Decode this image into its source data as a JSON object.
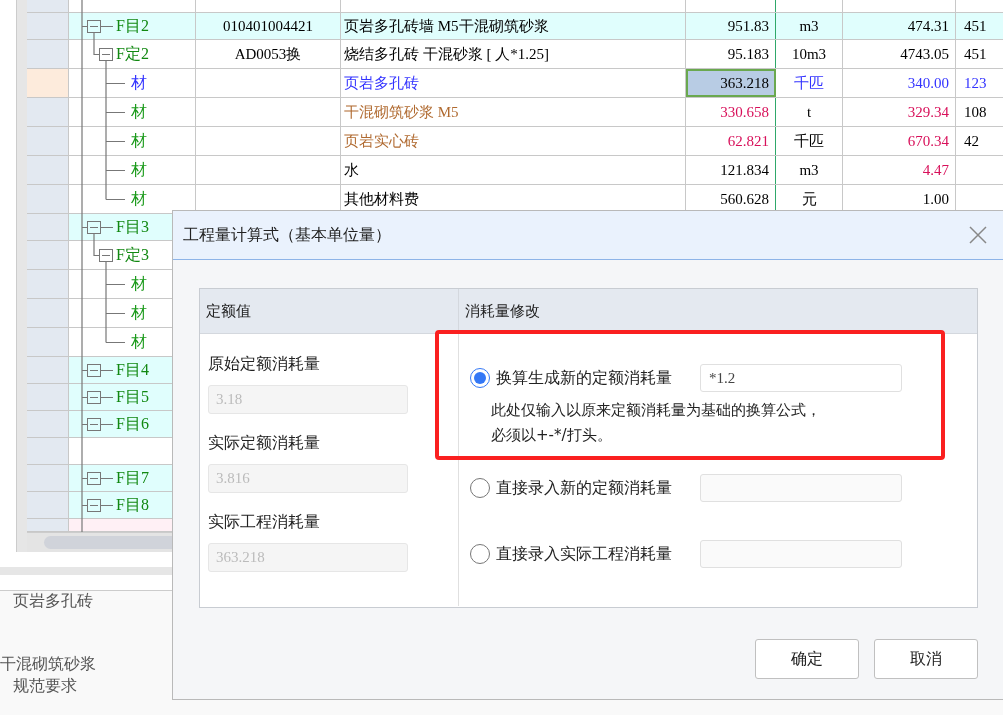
{
  "grid": {
    "rows": [
      {
        "kind": "material",
        "selected": false
      },
      {
        "kind": "item",
        "label": "F目2",
        "selected": false,
        "color": "#118811",
        "cells": {
          "code": {
            "text": "010401004421",
            "color": "#000000"
          },
          "name": {
            "text": "页岩多孔砖墙 M5干混砌筑砂浆",
            "color": "#000000"
          },
          "qty": {
            "text": "951.83",
            "color": "#000000"
          },
          "unit": {
            "text": "m3",
            "color": "#000000"
          },
          "price": {
            "text": "474.31",
            "color": "#000000"
          },
          "col_7": {
            "text": "451",
            "color": "#000000"
          }
        }
      },
      {
        "kind": "quota",
        "label": "F定2",
        "selected": false,
        "color": "#118811",
        "cells": {
          "code": {
            "text": "AD0053换",
            "color": "#000000"
          },
          "name": {
            "text": "烧结多孔砖 干混砂浆 [ 人*1.25]",
            "color": "#000000"
          },
          "qty": {
            "text": "95.183",
            "color": "#000000"
          },
          "unit": {
            "text": "10m3",
            "color": "#000000"
          },
          "price": {
            "text": "4743.05",
            "color": "#000000"
          },
          "col_7": {
            "text": "451",
            "color": "#000000"
          }
        }
      },
      {
        "kind": "material",
        "label": "材",
        "selected": true,
        "color": "#3333ff",
        "cells": {
          "name": {
            "text": "页岩多孔砖",
            "color": "#3333ff"
          },
          "qty": {
            "text": "363.218",
            "color": "#000000"
          },
          "unit": {
            "text": "千匹",
            "color": "#3333ff"
          },
          "price": {
            "text": "340.00",
            "color": "#3333ff"
          },
          "col_7": {
            "text": "123",
            "color": "#3333ff"
          }
        }
      },
      {
        "kind": "material",
        "label": "材",
        "selected": false,
        "color": "#1a9a1a",
        "cells": {
          "name": {
            "text": "干混砌筑砂浆 M5",
            "color": "#b06a30"
          },
          "qty": {
            "text": "330.658",
            "color": "#d8105a"
          },
          "unit": {
            "text": "t"
          },
          "price": {
            "text": "329.34",
            "color": "#d8105a"
          },
          "col_7": {
            "text": "108",
            "color": "#000000"
          }
        }
      },
      {
        "kind": "material",
        "label": "材",
        "selected": false,
        "color": "#1a9a1a",
        "cells": {
          "name": {
            "text": "页岩实心砖",
            "color": "#b06a30"
          },
          "qty": {
            "text": "62.821",
            "color": "#d8105a"
          },
          "unit": {
            "text": "千匹",
            "color": "#000000"
          },
          "price": {
            "text": "670.34",
            "color": "#d8105a"
          },
          "col_7": {
            "text": "42",
            "color": "#000000"
          }
        }
      },
      {
        "kind": "material",
        "label": "材",
        "selected": false,
        "color": "#1a9a1a",
        "cells": {
          "name": {
            "text": "水",
            "color": "#000000"
          },
          "qty": {
            "text": "121.834",
            "color": "#000000"
          },
          "unit": {
            "text": "m3",
            "color": "#000000"
          },
          "price": {
            "text": "4.47",
            "color": "#d8105a"
          }
        }
      },
      {
        "kind": "material",
        "label": "材",
        "selected": false,
        "color": "#1a9a1a",
        "cells": {
          "name": {
            "text": "其他材料费",
            "color": "#000000"
          },
          "qty": {
            "text": "560.628",
            "color": "#000000"
          },
          "unit": {
            "text": "元"
          },
          "price": {
            "text": "1.00",
            "color": "#000000"
          }
        }
      },
      {
        "kind": "item",
        "label": "F目3",
        "selected": false,
        "color": "#118811"
      },
      {
        "kind": "quota",
        "label": "F定3",
        "selected": false,
        "color": "#118811"
      },
      {
        "kind": "material",
        "label": "材",
        "selected": false,
        "color": "#1a9a1a"
      },
      {
        "kind": "material",
        "label": "材",
        "selected": false,
        "color": "#1a9a1a"
      },
      {
        "kind": "material",
        "label": "材",
        "selected": false,
        "color": "#1a9a1a"
      },
      {
        "kind": "item",
        "label": "F目4",
        "selected": false,
        "color": "#118811"
      },
      {
        "kind": "item",
        "label": "F目5",
        "selected": false,
        "color": "#118811"
      },
      {
        "kind": "item",
        "label": "F目6",
        "selected": false,
        "color": "#118811"
      },
      {
        "kind": "blank",
        "selected": false
      },
      {
        "kind": "item",
        "label": "F目7",
        "selected": false,
        "color": "#118811"
      },
      {
        "kind": "item",
        "label": "F目8",
        "selected": false,
        "color": "#118811"
      },
      {
        "kind": "section",
        "selected": false
      }
    ]
  },
  "detail_pane": {
    "lines": [
      "页岩多孔砖",
      "干混砌筑砂浆",
      "规范要求"
    ]
  },
  "dialog": {
    "title": "工程量计算式（基本单位量）",
    "left_header": "定额值",
    "right_header": "消耗量修改",
    "readings": [
      {
        "label": "原始定额消耗量",
        "value": "3.18",
        "disabled": true
      },
      {
        "label": "实际定额消耗量",
        "value": "3.816",
        "disabled": true
      },
      {
        "label": "实际工程消耗量",
        "value": "363.218",
        "disabled": true
      }
    ],
    "options": [
      {
        "label": "换算生成新的定额消耗量",
        "selected": true,
        "highlighted": true,
        "value": "*1.2",
        "note": [
          "此处仅输入以原来定额消耗量为基础的换算公式，",
          "必须以+-*/打头。"
        ]
      },
      {
        "label": "直接录入新的定额消耗量",
        "selected": false,
        "highlighted": false
      },
      {
        "label": "直接录入实际工程消耗量",
        "selected": false,
        "highlighted": false
      }
    ],
    "buttons": [
      "确定",
      "取消"
    ]
  }
}
